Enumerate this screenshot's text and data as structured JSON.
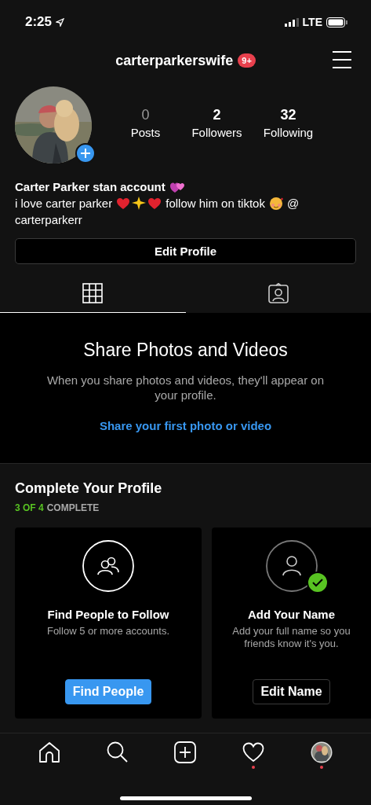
{
  "status_bar": {
    "time": "2:25",
    "network": "LTE"
  },
  "header": {
    "username": "carterparkerswife",
    "badge": "9+"
  },
  "stats": [
    {
      "count": "0",
      "label": "Posts",
      "disabled": true
    },
    {
      "count": "2",
      "label": "Followers",
      "disabled": false
    },
    {
      "count": "32",
      "label": "Following",
      "disabled": false
    }
  ],
  "bio": {
    "title": "Carter Parker stan account",
    "parts": [
      "i love carter parker",
      "follow him on tiktok",
      "@"
    ],
    "handle": "carterparkerr"
  },
  "edit_button": "Edit Profile",
  "tabs": [
    {
      "kind": "grid",
      "selected": true
    },
    {
      "kind": "tagged",
      "selected": false
    }
  ],
  "empty_state": {
    "title": "Share Photos and Videos",
    "description": "When you share photos and videos, they'll appear on your profile.",
    "link": "Share your first photo or video"
  },
  "complete_profile": {
    "title": "Complete Your Profile",
    "progress": "3 OF 4",
    "progress_label": "COMPLETE",
    "cards": [
      {
        "kind": "people",
        "title": "Find People to Follow",
        "description": [
          "Follow 5 or more accounts."
        ],
        "button": "Find People",
        "primary": true,
        "complete": false
      },
      {
        "kind": "name",
        "title": "Add Your Name",
        "description": [
          "Add your full name so you",
          "friends know it's you."
        ],
        "button": "Edit Name",
        "primary": false,
        "complete": true
      }
    ]
  },
  "bottom_nav": [
    {
      "kind": "home",
      "dot": false
    },
    {
      "kind": "search",
      "dot": false
    },
    {
      "kind": "add",
      "dot": false
    },
    {
      "kind": "heart",
      "dot": true
    },
    {
      "kind": "avatar",
      "dot": true
    }
  ]
}
